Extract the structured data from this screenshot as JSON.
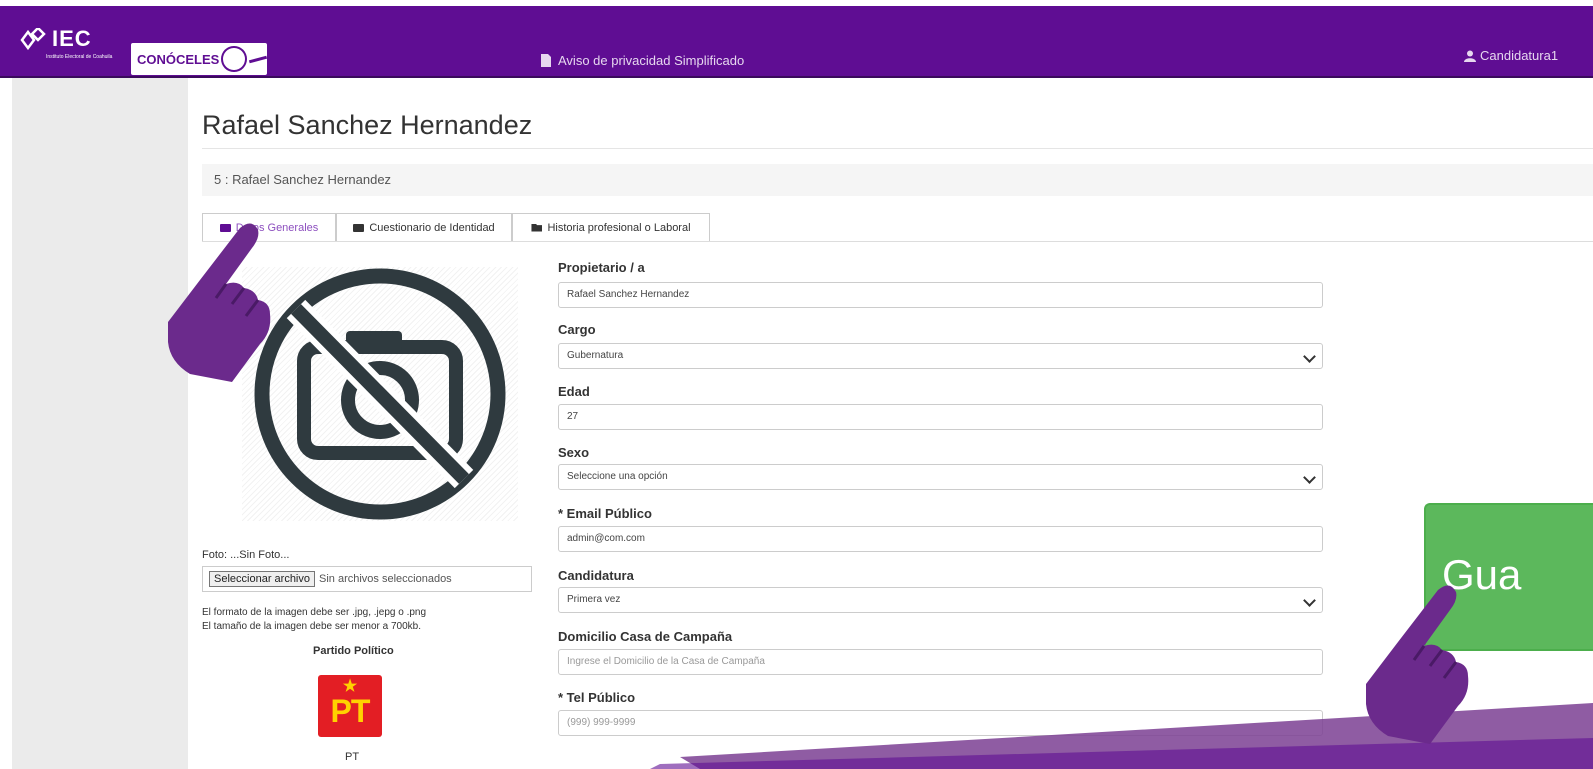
{
  "header": {
    "logo_text": "IEC",
    "logo_subtitle": "Instituto Electoral de Coahuila",
    "conoceles_text": "CONÓCELES",
    "privacy_link": "Aviso de privacidad Simplificado",
    "user_label": "Candidatura1"
  },
  "page": {
    "title": "Rafael Sanchez Hernandez",
    "breadcrumb": "5 : Rafael Sanchez Hernandez"
  },
  "tabs": [
    {
      "label": "Datos Generales",
      "active": true
    },
    {
      "label": "Cuestionario de Identidad",
      "active": false
    },
    {
      "label": "Historia profesional o Laboral",
      "active": false
    }
  ],
  "photo": {
    "label": "Foto: ...Sin Foto...",
    "file_button": "Seleccionar archivo",
    "file_status": "Sin archivos seleccionados",
    "hint_format": "El formato de la imagen debe ser .jpg, .jepg o .png",
    "hint_size": "El tamaño de la imagen debe ser menor a 700kb."
  },
  "party": {
    "label": "Partido Político",
    "logo_text": "PT",
    "name": "PT"
  },
  "form": {
    "propietario_label": "Propietario / a",
    "propietario_value": "Rafael Sanchez Hernandez",
    "cargo_label": "Cargo",
    "cargo_value": "Gubernatura",
    "edad_label": "Edad",
    "edad_value": "27",
    "sexo_label": "Sexo",
    "sexo_value": "Seleccione una opción",
    "email_label": "* Email Público",
    "email_value": "admin@com.com",
    "candidatura_label": "Candidatura",
    "candidatura_value": "Primera vez",
    "domicilio_label": "Domicilio Casa de Campaña",
    "domicilio_placeholder": "Ingrese el Domicilio de la Casa de Campaña",
    "tel_label": "* Tel Público",
    "tel_placeholder": "(999) 999-9999"
  },
  "save_button": "Gua",
  "colors": {
    "header": "#5f0d93",
    "save": "#5cb85c",
    "hand": "#6b2a8c",
    "party_red": "#e31e24",
    "party_yellow": "#ffd200"
  }
}
